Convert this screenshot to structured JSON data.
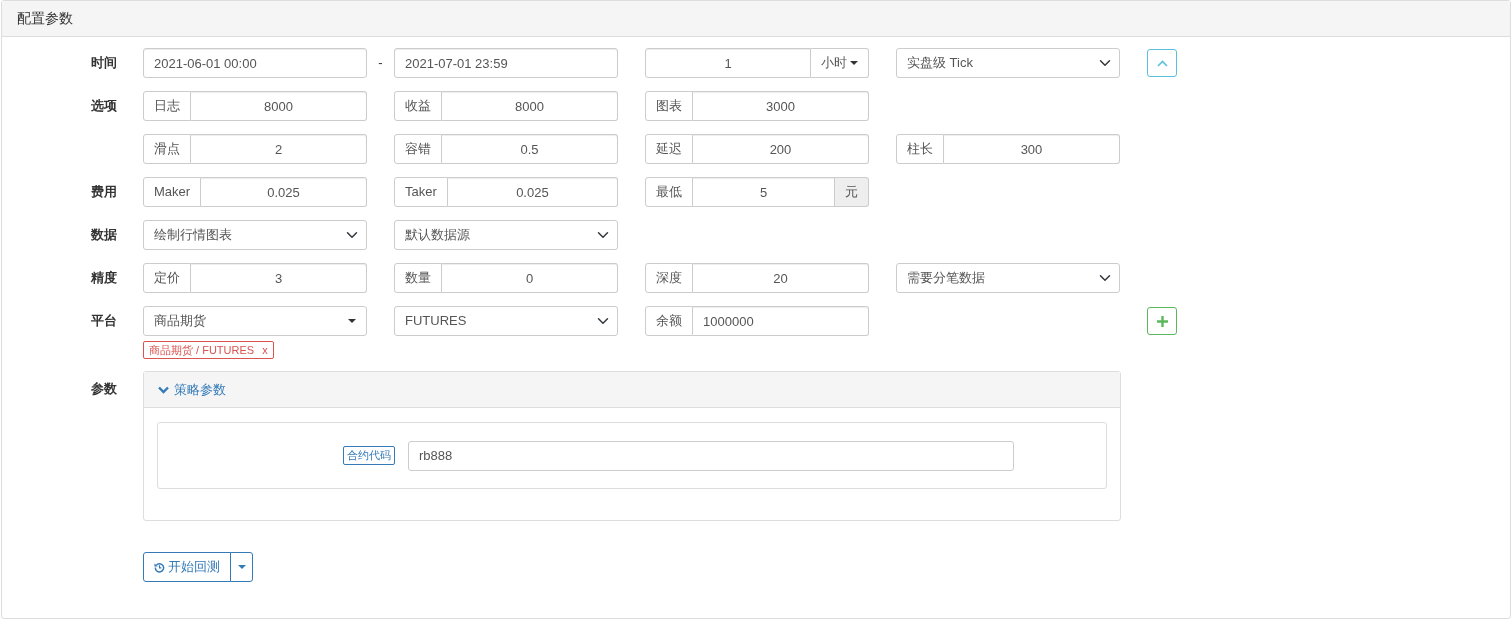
{
  "header": {
    "title": "配置参数"
  },
  "rows": [
    {
      "label": "时间",
      "items": [
        {
          "kind": "input",
          "value": "2021-06-01 00:00",
          "centered": false
        },
        {
          "kind": "dash",
          "text": "-"
        },
        {
          "kind": "input",
          "value": "2021-07-01 23:59",
          "centered": false
        },
        {
          "kind": "period",
          "value": "1",
          "unit": "小时",
          "centered": true
        },
        {
          "kind": "select",
          "value": "实盘级 Tick"
        }
      ],
      "side_button": {
        "kind": "collapse"
      }
    },
    {
      "label": "选项",
      "items": [
        {
          "kind": "addon",
          "prefix": "日志",
          "value": "8000",
          "centered": true
        },
        {
          "kind": "addon",
          "prefix": "收益",
          "value": "8000",
          "centered": true
        },
        {
          "kind": "addon",
          "prefix": "图表",
          "value": "3000",
          "centered": true
        }
      ]
    },
    {
      "items": [
        {
          "kind": "addon",
          "prefix": "滑点",
          "value": "2",
          "centered": true
        },
        {
          "kind": "addon",
          "prefix": "容错",
          "value": "0.5",
          "centered": true
        },
        {
          "kind": "addon",
          "prefix": "延迟",
          "value": "200",
          "centered": true
        },
        {
          "kind": "addon",
          "prefix": "柱长",
          "value": "300",
          "centered": true
        }
      ]
    },
    {
      "label": "费用",
      "items": [
        {
          "kind": "addon",
          "prefix": "Maker",
          "value": "0.025",
          "centered": true
        },
        {
          "kind": "addon",
          "prefix": "Taker",
          "value": "0.025",
          "centered": true
        },
        {
          "kind": "addon",
          "prefix": "最低",
          "value": "5",
          "suffix": "元",
          "centered": true
        }
      ]
    },
    {
      "label": "数据",
      "items": [
        {
          "kind": "select",
          "value": "绘制行情图表"
        },
        {
          "kind": "select",
          "value": "默认数据源"
        }
      ]
    },
    {
      "label": "精度",
      "items": [
        {
          "kind": "addon",
          "prefix": "定价",
          "value": "3",
          "centered": true
        },
        {
          "kind": "addon",
          "prefix": "数量",
          "value": "0",
          "centered": true
        },
        {
          "kind": "addon",
          "prefix": "深度",
          "value": "20",
          "centered": true
        },
        {
          "kind": "select",
          "value": "需要分笔数据"
        }
      ]
    },
    {
      "label": "平台",
      "items": [
        {
          "kind": "menu",
          "value": "商品期货"
        },
        {
          "kind": "select",
          "value": "FUTURES"
        },
        {
          "kind": "addon",
          "prefix": "余额",
          "value": "1000000",
          "centered": false
        }
      ],
      "side_button": {
        "kind": "add"
      }
    }
  ],
  "tags": [
    {
      "label": "商品期货 / FUTURES",
      "remove": "x"
    }
  ],
  "params": {
    "label": "参数",
    "panel": {
      "title": "策略参数",
      "expanded": true,
      "fields": [
        {
          "label": "合约代码",
          "value": "rb888"
        }
      ]
    }
  },
  "start": {
    "label": "开始回测"
  }
}
